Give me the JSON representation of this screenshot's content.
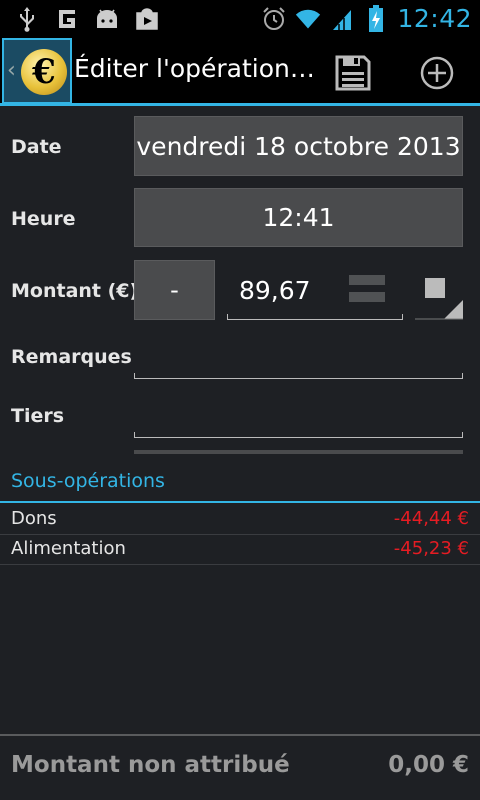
{
  "status_bar": {
    "time": "12:42",
    "icons": [
      "usb-icon",
      "g-icon",
      "android-debug-icon",
      "play-store-icon",
      "alarm-icon",
      "wifi-icon",
      "signal-icon",
      "battery-charging-icon"
    ]
  },
  "action_bar": {
    "title": "Éditer l'opération…",
    "logo_symbol": "€",
    "actions": [
      "save-icon",
      "add-icon"
    ]
  },
  "form": {
    "date_label": "Date",
    "date_value": "vendredi 18 octobre 2013",
    "time_label": "Heure",
    "time_value": "12:41",
    "amount_label": "Montant (€)",
    "sign_value": "-",
    "amount_value": "89,67",
    "remarks_label": "Remarques",
    "remarks_value": "",
    "thirdparty_label": "Tiers",
    "thirdparty_value": ""
  },
  "suboperations": {
    "header": "Sous-opérations",
    "items": [
      {
        "name": "Dons",
        "amount": "-44,44 €"
      },
      {
        "name": "Alimentation",
        "amount": "-45,23 €"
      }
    ]
  },
  "footer": {
    "label": "Montant non attribué",
    "value": "0,00 €"
  },
  "colors": {
    "accent": "#33b5e5",
    "negative": "#e51c23",
    "background": "#1e2024"
  }
}
